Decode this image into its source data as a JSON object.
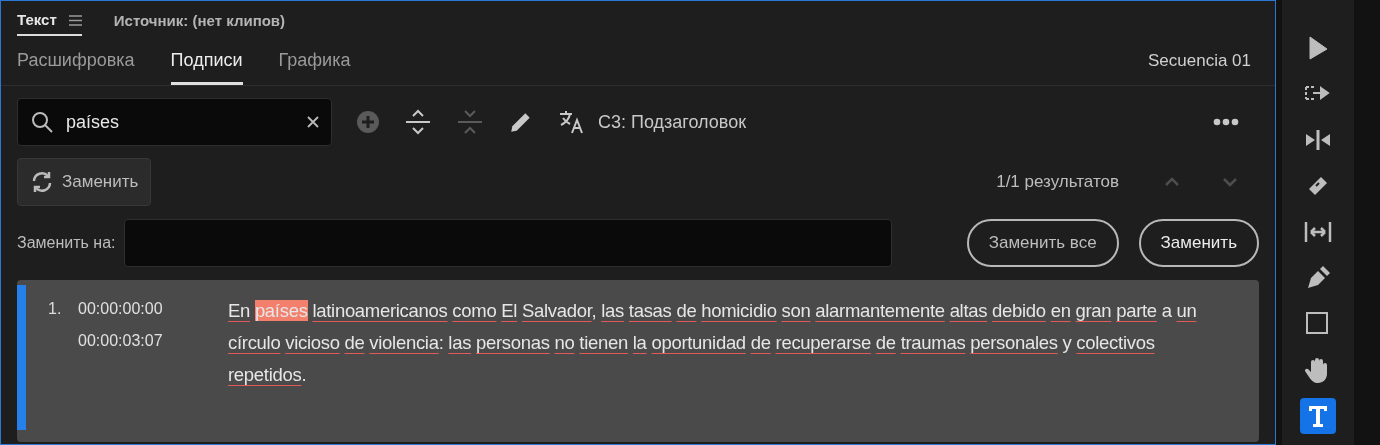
{
  "panel_tabs": [
    {
      "label": "Текст",
      "selected": true
    },
    {
      "label": "Источник: (нет клипов)",
      "selected": false
    }
  ],
  "tabs": [
    {
      "label": "Расшифровка",
      "selected": false
    },
    {
      "label": "Подписи",
      "selected": true
    },
    {
      "label": "Графика",
      "selected": false
    }
  ],
  "sequence": "Secuencia 01",
  "search": {
    "value": "países"
  },
  "toolbar": [
    {
      "kind": "add",
      "disabled": true
    },
    {
      "kind": "expand",
      "disabled": false
    },
    {
      "kind": "split",
      "disabled": true
    },
    {
      "kind": "edit",
      "disabled": false
    },
    {
      "kind": "translate",
      "disabled": false
    }
  ],
  "caption_style": "С3: Подзаголовок",
  "replace_toggle": {
    "label": "Заменить"
  },
  "results": "1/1 результатов",
  "nav": [
    {
      "kind": "up",
      "disabled": true
    },
    {
      "kind": "down",
      "disabled": true
    }
  ],
  "replace_with": {
    "label": "Заменить на:"
  },
  "buttons": [
    "Заменить все",
    "Заменить"
  ],
  "captions": [
    {
      "number": "1.",
      "start": "00:00:00:00",
      "end": "00:00:03:07",
      "selected": true,
      "lines": [
        [
          {
            "kind": "word",
            "w": "En",
            "flagged": true,
            "match": false
          },
          {
            "kind": "word",
            "w": "países",
            "flagged": false,
            "match": true
          },
          {
            "kind": "word",
            "w": "latinoamericanos",
            "flagged": true,
            "match": false
          },
          {
            "kind": "word",
            "w": "como",
            "flagged": true,
            "match": false
          },
          {
            "kind": "word",
            "w": "El",
            "flagged": true,
            "match": false
          },
          {
            "kind": "word",
            "w": "Salvador",
            "flagged": true,
            "match": false
          },
          {
            "kind": "punct",
            "w": ","
          },
          {
            "kind": "word",
            "w": "las",
            "flagged": true,
            "match": false
          },
          {
            "kind": "word",
            "w": "tasas",
            "flagged": true,
            "match": false
          },
          {
            "kind": "word",
            "w": "de",
            "flagged": true,
            "match": false
          },
          {
            "kind": "word",
            "w": "homicidio",
            "flagged": true,
            "match": false
          },
          {
            "kind": "word",
            "w": "son",
            "flagged": true,
            "match": false
          },
          {
            "kind": "word",
            "w": "alarmantemente",
            "flagged": true,
            "match": false
          },
          {
            "kind": "word",
            "w": "altas",
            "flagged": true,
            "match": false
          },
          {
            "kind": "word",
            "w": "debido",
            "flagged": true,
            "match": false
          },
          {
            "kind": "word",
            "w": "en",
            "flagged": true,
            "match": false
          },
          {
            "kind": "word",
            "w": "gran",
            "flagged": true,
            "match": false
          },
          {
            "kind": "word",
            "w": "parte",
            "flagged": true,
            "match": false
          },
          {
            "kind": "word",
            "w": "a",
            "flagged": false,
            "match": false
          },
          {
            "kind": "word",
            "w": "un",
            "flagged": true,
            "match": false
          }
        ],
        [
          {
            "kind": "word",
            "w": "círculo",
            "flagged": true,
            "match": false
          },
          {
            "kind": "word",
            "w": "vicioso",
            "flagged": true,
            "match": false
          },
          {
            "kind": "word",
            "w": "de",
            "flagged": true,
            "match": false
          },
          {
            "kind": "word",
            "w": "violencia",
            "flagged": true,
            "match": false
          },
          {
            "kind": "punct",
            "w": ":"
          },
          {
            "kind": "word",
            "w": "las",
            "flagged": true,
            "match": false
          },
          {
            "kind": "word",
            "w": "personas",
            "flagged": true,
            "match": false
          },
          {
            "kind": "word",
            "w": "no",
            "flagged": true,
            "match": false
          },
          {
            "kind": "word",
            "w": "tienen",
            "flagged": true,
            "match": false
          },
          {
            "kind": "word",
            "w": "la",
            "flagged": true,
            "match": false
          },
          {
            "kind": "word",
            "w": "oportunidad",
            "flagged": true,
            "match": false
          },
          {
            "kind": "word",
            "w": "de",
            "flagged": true,
            "match": false
          },
          {
            "kind": "word",
            "w": "recuperarse",
            "flagged": true,
            "match": false
          },
          {
            "kind": "word",
            "w": "de",
            "flagged": true,
            "match": false
          },
          {
            "kind": "word",
            "w": "traumas",
            "flagged": true,
            "match": false
          },
          {
            "kind": "word",
            "w": "personales",
            "flagged": true,
            "match": false
          },
          {
            "kind": "word",
            "w": "y",
            "flagged": false,
            "match": false
          },
          {
            "kind": "word",
            "w": "colectivos",
            "flagged": true,
            "match": false
          }
        ],
        [
          {
            "kind": "word",
            "w": "repetidos",
            "flagged": true,
            "match": false
          },
          {
            "kind": "punct",
            "w": "."
          }
        ]
      ]
    }
  ],
  "tools": [
    {
      "kind": "select",
      "selected": false
    },
    {
      "kind": "track",
      "selected": false
    },
    {
      "kind": "ripple",
      "selected": false
    },
    {
      "kind": "razor",
      "selected": false
    },
    {
      "kind": "slip",
      "selected": false
    },
    {
      "kind": "pen",
      "selected": false
    },
    {
      "kind": "rect",
      "selected": false
    },
    {
      "kind": "hand",
      "selected": false
    },
    {
      "kind": "type",
      "selected": true
    }
  ]
}
